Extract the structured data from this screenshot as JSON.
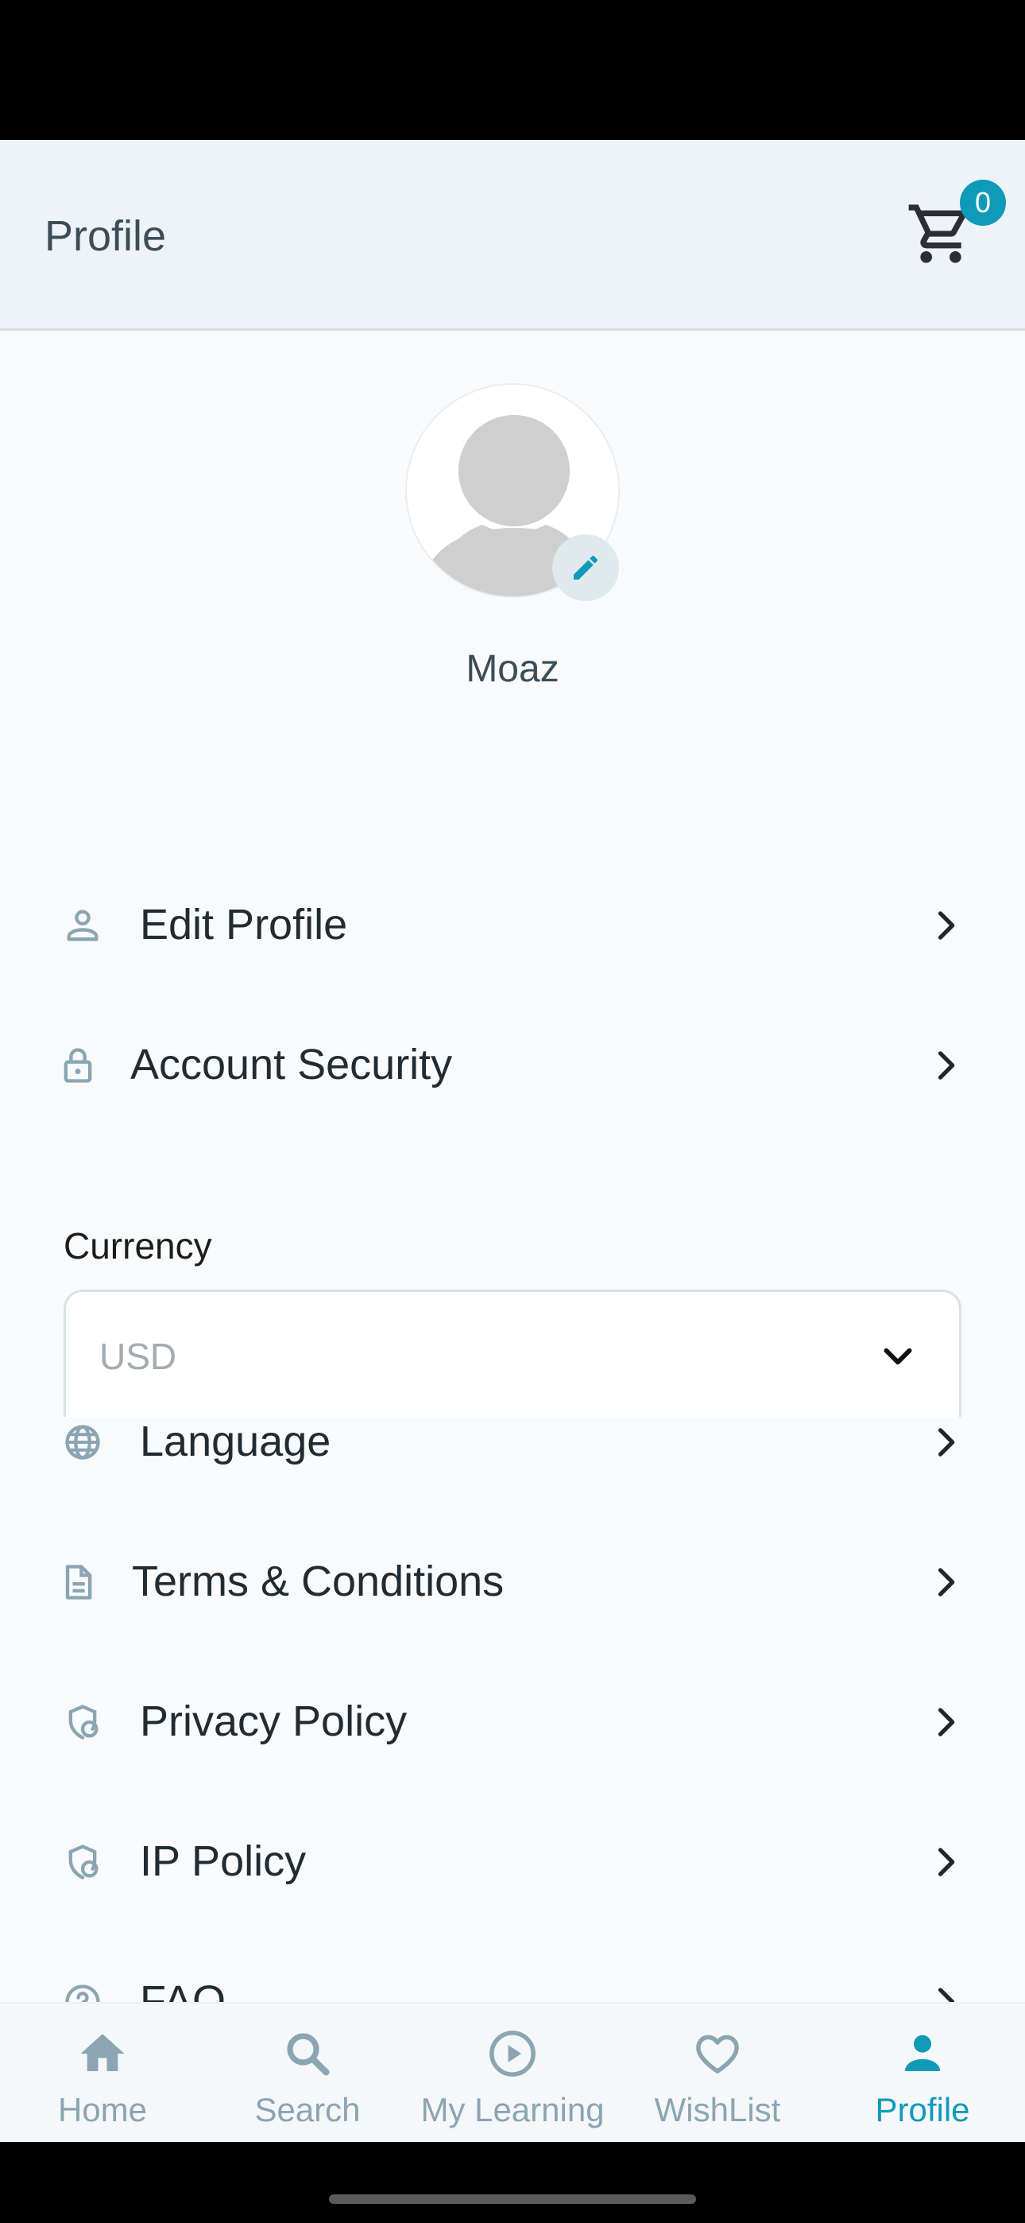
{
  "header": {
    "title": "Profile",
    "cart_count": "0",
    "cart_icon": "shopping-cart-icon"
  },
  "profile": {
    "name": "Moaz",
    "avatar_icon": "user-placeholder-icon",
    "edit_icon": "pencil-icon"
  },
  "menu": {
    "edit_profile": "Edit Profile",
    "account_security": "Account Security",
    "language": "Language",
    "terms": "Terms & Conditions",
    "privacy": "Privacy Policy",
    "ip_policy": "IP Policy",
    "faq": "FAQ"
  },
  "currency": {
    "label": "Currency",
    "selected": "USD"
  },
  "tabs": {
    "home": "Home",
    "search": "Search",
    "learning": "My Learning",
    "wishlist": "WishList",
    "profile": "Profile",
    "active": "Profile"
  },
  "colors": {
    "accent": "#0f9ab8",
    "header_bg": "#eef3f7",
    "icon_muted": "#8ba5b2",
    "text_dark": "#212b32"
  }
}
